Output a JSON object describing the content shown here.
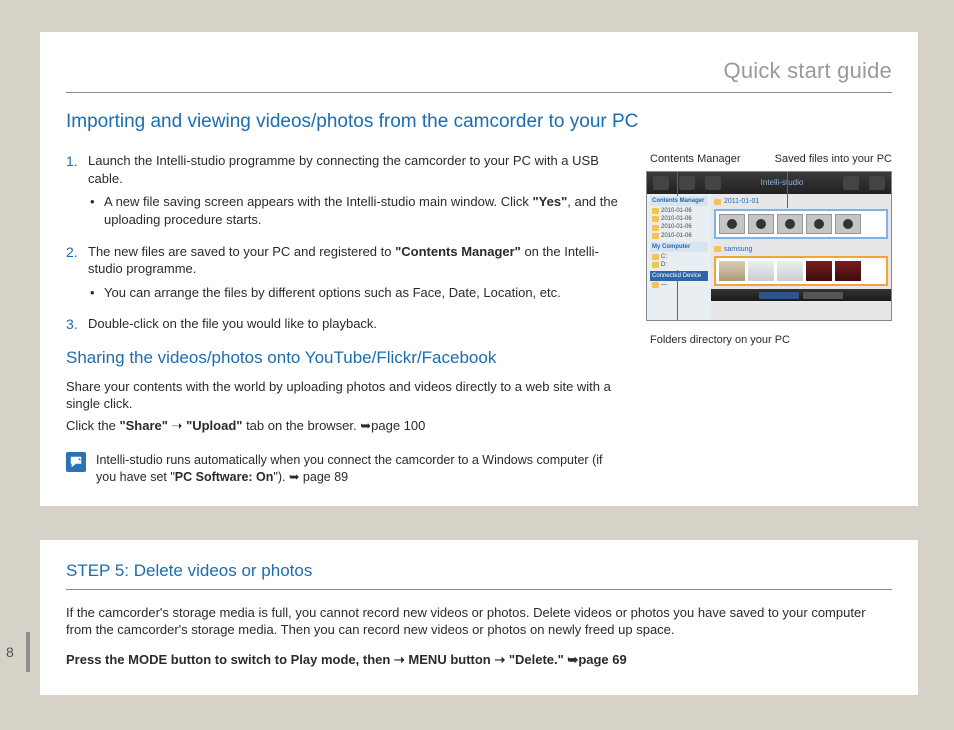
{
  "chapter_title": "Quick start guide",
  "section_heading": "Importing and viewing videos/photos from the camcorder to your PC",
  "steps": {
    "s1": {
      "num": "1.",
      "text": "Launch the Intelli-studio programme by connecting the camcorder to your PC with a USB cable.",
      "bullet_a_pre": "A new file saving screen appears with the Intelli-studio main window. Click ",
      "bullet_a_bold": "\"Yes\"",
      "bullet_a_post": ", and the uploading procedure starts."
    },
    "s2": {
      "num": "2.",
      "text_pre": "The new files are saved to your PC and registered to ",
      "text_bold": "\"Contents Manager\"",
      "text_post": " on the Intelli-studio programme.",
      "bullet_a": "You can arrange the files by different options such as Face, Date, Location, etc."
    },
    "s3": {
      "num": "3.",
      "text": "Double-click on the file you would like to playback."
    }
  },
  "sub_heading": "Sharing the videos/photos onto YouTube/Flickr/Facebook",
  "share_body1": "Share your contents with the world by uploading photos and videos directly to a web site with a single click.",
  "share_body2_pre": "Click the ",
  "share_body2_bold1": "\"Share\"",
  "share_arrow": " ➝ ",
  "share_body2_bold2": "\"Upload\"",
  "share_body2_post": " tab on the browser. ➥page 100",
  "note_pre": "Intelli-studio runs automatically when you connect the camcorder to a Windows computer (if you have set \"",
  "note_bold": "PC Software: On",
  "note_post": "\"). ➥ page 89",
  "right": {
    "label_left": "Contents Manager",
    "label_right": "Saved files into your PC",
    "under_label": "Folders directory on your PC",
    "app_title": "Intelli-studio",
    "side_hdr1": "Contents Manager",
    "dates": [
      "2010-01-06",
      "2010-01-06",
      "2010-01-06",
      "2010-01-06"
    ],
    "side_hdr2": "My Computer",
    "blue_hdr": "Connected Device",
    "panel1": "2011-01-01",
    "panel2": "samsung"
  },
  "step5": {
    "heading": "STEP 5: Delete videos or photos",
    "body": "If the camcorder's storage media is full, you cannot record new videos or photos. Delete videos or photos you have saved to your computer from the camcorder's storage media. Then you can record new videos or photos on newly freed up space.",
    "bold_line": "Press the MODE button to switch to Play mode, then ➝ MENU button ➝ \"Delete.\" ➥page 69"
  },
  "page_number": "8"
}
